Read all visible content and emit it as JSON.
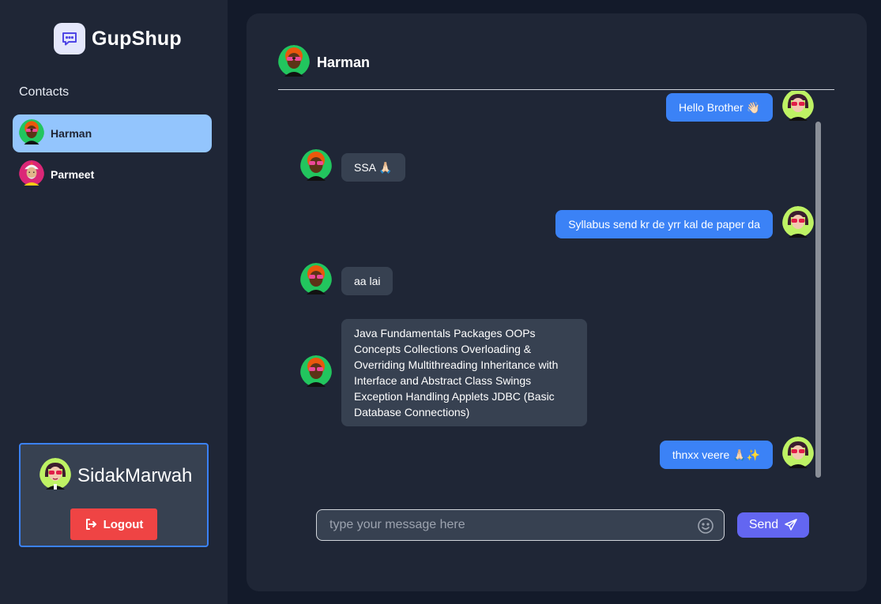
{
  "app": {
    "name": "GupShup",
    "logo_icon": "chat-bubble-icon",
    "accent": "#6366f1"
  },
  "sidebar": {
    "heading": "Contacts",
    "contacts": [
      {
        "name": "Harman",
        "active": true,
        "avatar_icon": "avatar-harman"
      },
      {
        "name": "Parmeet",
        "active": false,
        "avatar_icon": "avatar-parmeet"
      }
    ]
  },
  "current_user": {
    "name": "SidakMarwah",
    "avatar_icon": "avatar-sidak",
    "logout_label": "Logout",
    "logout_color": "#ef4444"
  },
  "chat": {
    "contact_name": "Harman",
    "messages": [
      {
        "direction": "out",
        "text": "Hello Brother 👋🏻"
      },
      {
        "direction": "in",
        "text": "SSA 🙏🏻"
      },
      {
        "direction": "out",
        "text": "Syllabus send kr de yrr kal de paper da"
      },
      {
        "direction": "in",
        "text": "aa lai"
      },
      {
        "direction": "in",
        "text": "Java Fundamentals Packages OOPs Concepts Collections Overloading & Overriding Multithreading Inheritance with Interface and Abstract Class Swings Exception Handling Applets JDBC (Basic Database Connections)"
      },
      {
        "direction": "out",
        "text": "thnxx veere 🙏🏻✨"
      }
    ]
  },
  "composer": {
    "placeholder": "type your message here",
    "value": "",
    "send_label": "Send",
    "emoji_icon": "smiley-icon",
    "send_icon": "paper-plane-icon"
  }
}
